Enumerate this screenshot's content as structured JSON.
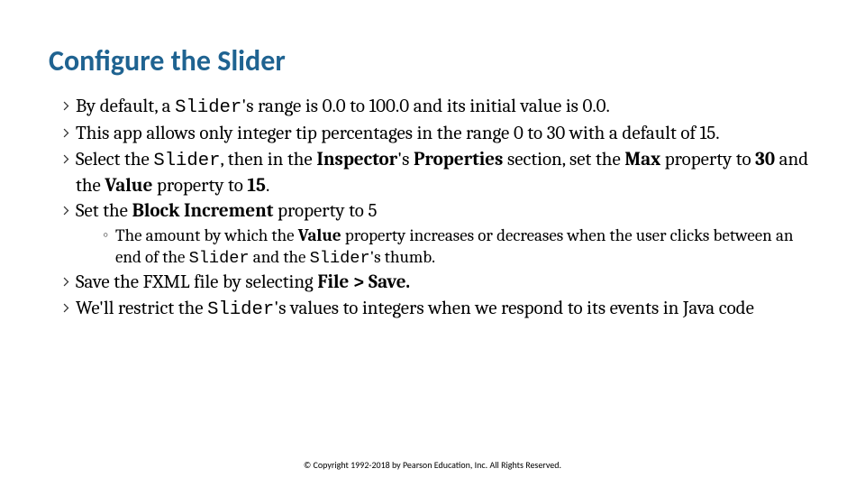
{
  "title": "Configure the Slider",
  "bullets": {
    "b1_pre": "By default, a ",
    "b1_code": "Slider",
    "b1_post": "'s range is 0.0 to 100.0 and its initial value is 0.0.",
    "b2": "This app allows only integer tip percentages in the range 0 to 30 with a default of 15.",
    "b3_pre": "Select the ",
    "b3_code": "Slider",
    "b3_mid1": ", then in the ",
    "b3_bold1": "Inspector",
    "b3_mid2": "'s ",
    "b3_bold2": "Properties",
    "b3_mid3": " section, set the ",
    "b3_bold3": "Max",
    "b3_mid4": " property to ",
    "b3_bold4": "30",
    "b3_mid5": " and the ",
    "b3_bold5": "Value",
    "b3_mid6": " property to ",
    "b3_bold6": "15",
    "b3_post": ".",
    "b4_pre": "Set the ",
    "b4_bold": "Block Increment",
    "b4_post": " property to 5",
    "b4sub_pre": "The amount by which the ",
    "b4sub_bold": "Value",
    "b4sub_mid1": " property increases or decreases when the user clicks between an end of the ",
    "b4sub_code1": "Slider",
    "b4sub_mid2": " and the ",
    "b4sub_code2": "Slider",
    "b4sub_post": "'s thumb.",
    "b5_pre": "Save the FXML file by selecting ",
    "b5_bold": "File > Save.",
    "b6_pre": "We'll restrict the ",
    "b6_code": "Slider",
    "b6_post": "'s values to integers when we respond to its events in Java code"
  },
  "footer": "© Copyright 1992-2018 by Pearson Education, Inc. All Rights Reserved."
}
